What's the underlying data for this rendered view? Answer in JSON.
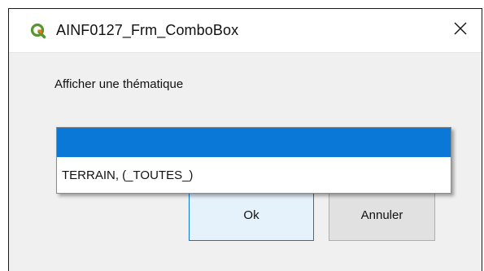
{
  "window": {
    "title": "AINF0127_Frm_ComboBox",
    "close_symbol": "✕",
    "app_icon": "qgis-icon",
    "colors": {
      "accent": "#0a78d7",
      "icon_green": "#589632",
      "icon_yellow": "#ee7913"
    }
  },
  "form": {
    "prompt_label": "Afficher une thématique"
  },
  "combobox": {
    "selected_value": "",
    "options": [
      {
        "label": ""
      },
      {
        "label": "TERRAIN, (_TOUTES_)"
      }
    ]
  },
  "buttons": {
    "ok_label": "Ok",
    "cancel_label": "Annuler"
  }
}
